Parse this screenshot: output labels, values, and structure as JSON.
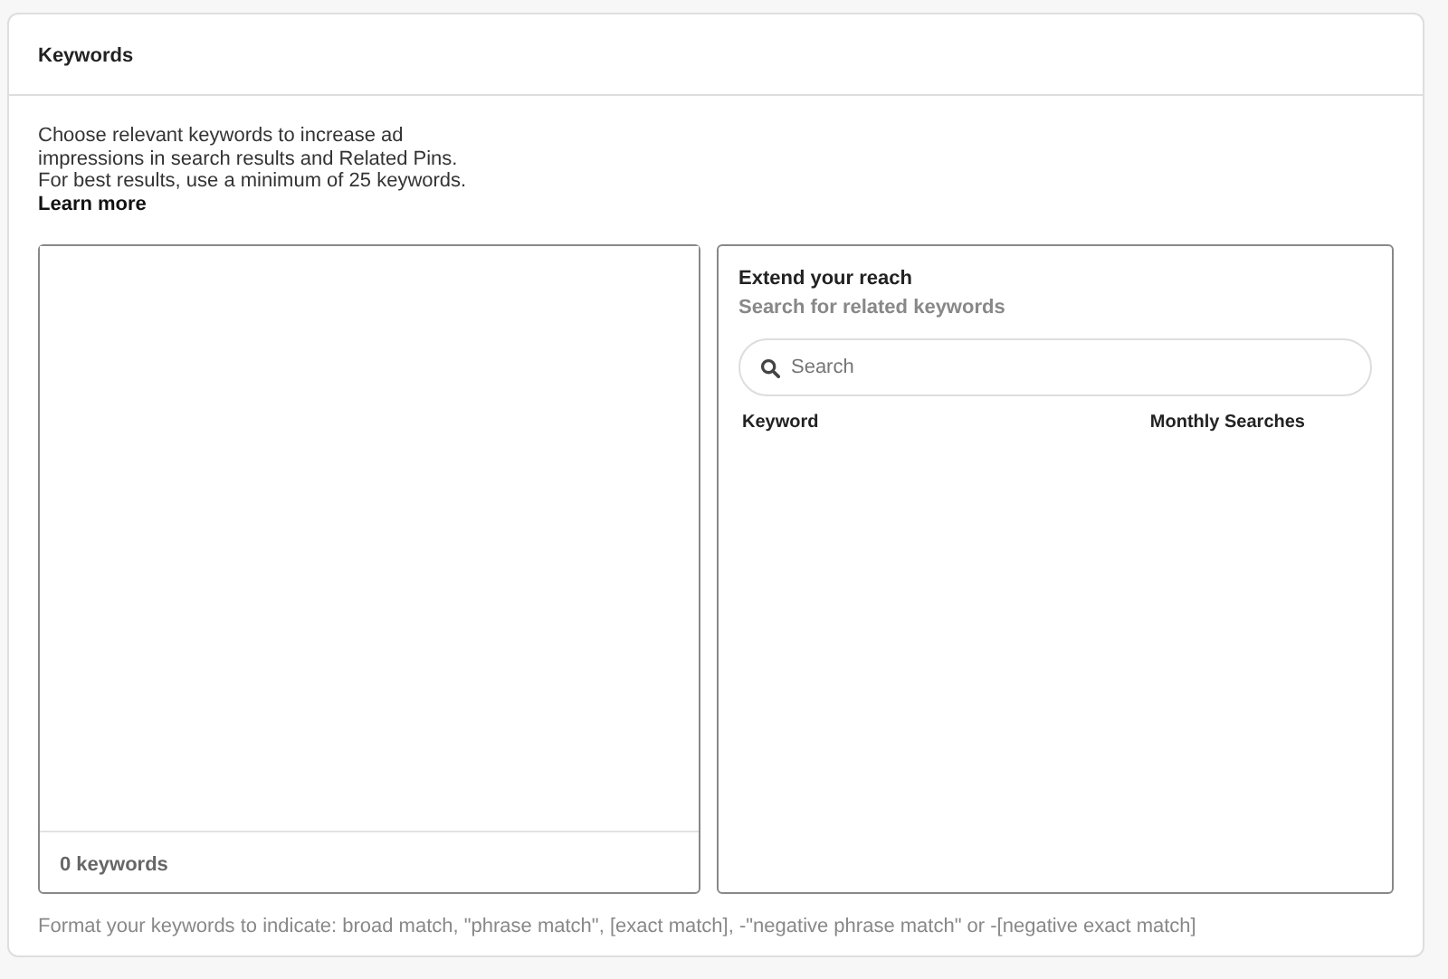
{
  "card": {
    "title": "Keywords"
  },
  "intro": {
    "text": "Choose relevant keywords to increase ad impressions in search results and Related Pins. For best results, use a minimum of 25 keywords.",
    "link": "Learn more"
  },
  "keyword_editor": {
    "count": "0 keywords"
  },
  "reach": {
    "title": "Extend your reach",
    "subtitle": "Search for related keywords",
    "search": {
      "placeholder": "Search"
    },
    "columns": [
      "Keyword",
      "Monthly Searches"
    ]
  },
  "hint": "Format your keywords to indicate: broad match, \"phrase match\", [exact match], -\"negative phrase match\" or -[negative exact match]"
}
